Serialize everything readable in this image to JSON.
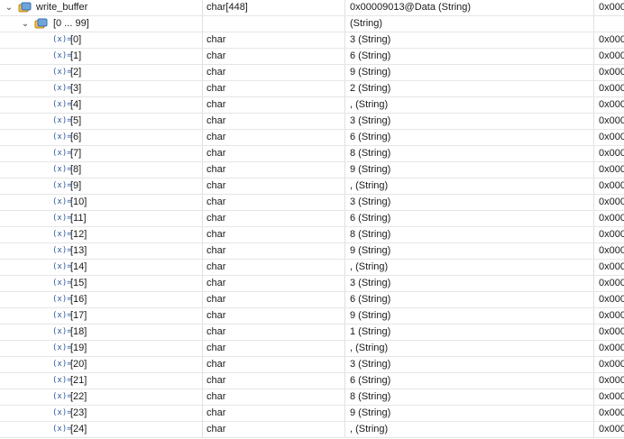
{
  "root": {
    "name": "write_buffer",
    "type": "char[448]",
    "value": "0x00009013@Data (String)",
    "address": "0x000",
    "icon": "object-icon",
    "expand_icon": "chevron-down-icon"
  },
  "range": {
    "name": "[0 ... 99]",
    "type": "",
    "value": "(String)",
    "address": "",
    "icon": "object-icon",
    "expand_icon": "chevron-down-icon"
  },
  "var_icon_text": "(x)=",
  "elements": [
    {
      "name": "[0]",
      "type": "char",
      "value": "3 (String)",
      "address": "0x000"
    },
    {
      "name": "[1]",
      "type": "char",
      "value": "6 (String)",
      "address": "0x000"
    },
    {
      "name": "[2]",
      "type": "char",
      "value": "9 (String)",
      "address": "0x000"
    },
    {
      "name": "[3]",
      "type": "char",
      "value": "2 (String)",
      "address": "0x000"
    },
    {
      "name": "[4]",
      "type": "char",
      "value": ", (String)",
      "address": "0x000"
    },
    {
      "name": "[5]",
      "type": "char",
      "value": "3 (String)",
      "address": "0x000"
    },
    {
      "name": "[6]",
      "type": "char",
      "value": "6 (String)",
      "address": "0x000"
    },
    {
      "name": "[7]",
      "type": "char",
      "value": "8 (String)",
      "address": "0x000"
    },
    {
      "name": "[8]",
      "type": "char",
      "value": "9 (String)",
      "address": "0x000"
    },
    {
      "name": "[9]",
      "type": "char",
      "value": ", (String)",
      "address": "0x000"
    },
    {
      "name": "[10]",
      "type": "char",
      "value": "3 (String)",
      "address": "0x000"
    },
    {
      "name": "[11]",
      "type": "char",
      "value": "6 (String)",
      "address": "0x000"
    },
    {
      "name": "[12]",
      "type": "char",
      "value": "8 (String)",
      "address": "0x000"
    },
    {
      "name": "[13]",
      "type": "char",
      "value": "9 (String)",
      "address": "0x000"
    },
    {
      "name": "[14]",
      "type": "char",
      "value": ", (String)",
      "address": "0x000"
    },
    {
      "name": "[15]",
      "type": "char",
      "value": "3 (String)",
      "address": "0x000"
    },
    {
      "name": "[16]",
      "type": "char",
      "value": "6 (String)",
      "address": "0x000"
    },
    {
      "name": "[17]",
      "type": "char",
      "value": "9 (String)",
      "address": "0x000"
    },
    {
      "name": "[18]",
      "type": "char",
      "value": "1 (String)",
      "address": "0x000"
    },
    {
      "name": "[19]",
      "type": "char",
      "value": ", (String)",
      "address": "0x000"
    },
    {
      "name": "[20]",
      "type": "char",
      "value": "3 (String)",
      "address": "0x000"
    },
    {
      "name": "[21]",
      "type": "char",
      "value": "6 (String)",
      "address": "0x000"
    },
    {
      "name": "[22]",
      "type": "char",
      "value": "8 (String)",
      "address": "0x000"
    },
    {
      "name": "[23]",
      "type": "char",
      "value": "9 (String)",
      "address": "0x000"
    },
    {
      "name": "[24]",
      "type": "char",
      "value": ", (String)",
      "address": "0x000"
    }
  ]
}
